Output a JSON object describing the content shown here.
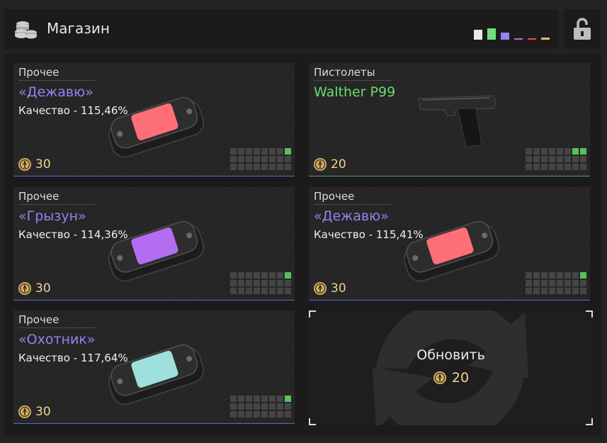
{
  "header": {
    "title": "Магазин",
    "rarity_colors": [
      "#e8e8e8",
      "#6fe07b",
      "#8d86f2",
      "#d65fd6",
      "#e24b4b",
      "#e8c34c"
    ]
  },
  "currency_icon": "compass-coin-icon",
  "cards": [
    {
      "category": "Прочее",
      "name": "«Дежавю»",
      "name_color": "#8d86f2",
      "quality": "Качество - 115,46%",
      "price": "30",
      "item": "capsule",
      "capsule_color": "#ff6f78",
      "border_color": "#6a60d8",
      "grid_on": [
        7
      ]
    },
    {
      "category": "Пистолеты",
      "name": "Walther P99",
      "name_color": "#67de6c",
      "quality": "",
      "price": "20",
      "item": "pistol",
      "border_color": "#4fae52",
      "grid_on": [
        6,
        7
      ]
    },
    {
      "category": "Прочее",
      "name": "«Грызун»",
      "name_color": "#8d86f2",
      "quality": "Качество - 114,36%",
      "price": "30",
      "item": "capsule",
      "capsule_color": "#b46cf0",
      "border_color": "#6a60d8",
      "grid_on": [
        7
      ]
    },
    {
      "category": "Прочее",
      "name": "«Дежавю»",
      "name_color": "#8d86f2",
      "quality": "Качество - 115,41%",
      "price": "30",
      "item": "capsule",
      "capsule_color": "#ff6f78",
      "border_color": "#6a60d8",
      "grid_on": [
        7
      ]
    },
    {
      "category": "Прочее",
      "name": "«Охотник»",
      "name_color": "#8d86f2",
      "quality": "Качество - 117,64%",
      "price": "30",
      "item": "capsule",
      "capsule_color": "#9ee0dd",
      "border_color": "#6a60d8",
      "grid_on": [
        7
      ]
    }
  ],
  "refresh": {
    "label": "Обновить",
    "price": "20"
  },
  "lock_icon": "unlocked-padlock-icon"
}
